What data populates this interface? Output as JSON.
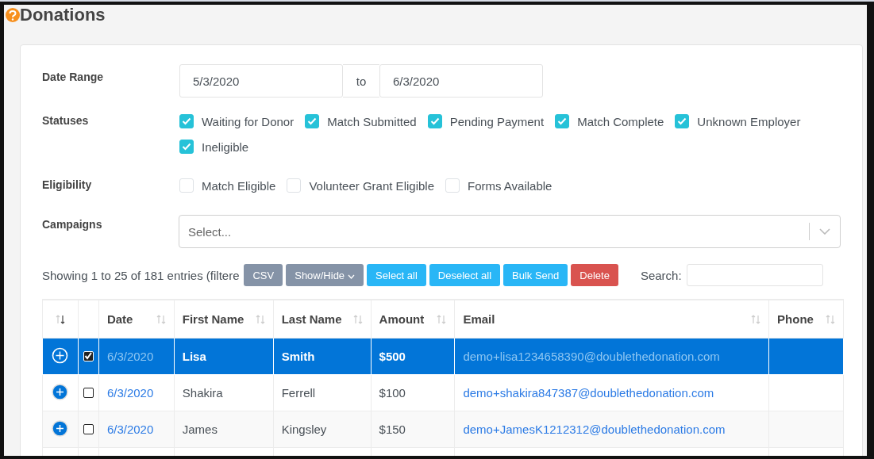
{
  "page": {
    "title": "Donations"
  },
  "filters": {
    "date_range": {
      "label": "Date Range",
      "from": "5/3/2020",
      "separator": "to",
      "to": "6/3/2020"
    },
    "statuses": {
      "label": "Statuses",
      "options": [
        {
          "label": "Waiting for Donor",
          "checked": true
        },
        {
          "label": "Match Submitted",
          "checked": true
        },
        {
          "label": "Pending Payment",
          "checked": true
        },
        {
          "label": "Match Complete",
          "checked": true
        },
        {
          "label": "Unknown Employer",
          "checked": true
        },
        {
          "label": "Ineligible",
          "checked": true
        }
      ]
    },
    "eligibility": {
      "label": "Eligibility",
      "options": [
        {
          "label": "Match Eligible",
          "checked": false
        },
        {
          "label": "Volunteer Grant Eligible",
          "checked": false
        },
        {
          "label": "Forms Available",
          "checked": false
        }
      ]
    },
    "campaigns": {
      "label": "Campaigns",
      "placeholder": "Select..."
    }
  },
  "toolbar": {
    "info": "Showing 1 to 25 of 181 entries (filtere",
    "buttons": [
      {
        "label": "CSV",
        "kind": "secondary"
      },
      {
        "label": "Show/Hide",
        "kind": "dropdown"
      },
      {
        "label": "Select all",
        "kind": "info"
      },
      {
        "label": "Deselect all",
        "kind": "info"
      },
      {
        "label": "Bulk Send",
        "kind": "info"
      },
      {
        "label": "Delete",
        "kind": "danger"
      }
    ],
    "search_label": "Search:"
  },
  "table": {
    "columns": [
      {
        "kind": "expand",
        "sorted": true
      },
      {
        "kind": "select"
      },
      {
        "kind": "data",
        "label": "Date",
        "sorted": false
      },
      {
        "kind": "data",
        "label": "First Name",
        "sorted": false
      },
      {
        "kind": "data",
        "label": "Last Name",
        "sorted": false
      },
      {
        "kind": "data",
        "label": "Amount",
        "sorted": false
      },
      {
        "kind": "data",
        "label": "Email",
        "sorted": false
      },
      {
        "kind": "data",
        "label": "Phone",
        "sorted": false
      }
    ],
    "rows": [
      {
        "selected": true,
        "checked": true,
        "date": "6/3/2020",
        "first_name": "Lisa",
        "last_name": "Smith",
        "amount": "$500",
        "email": "demo+lisa1234658390@doublethedonation.com"
      },
      {
        "selected": false,
        "checked": false,
        "date": "6/3/2020",
        "first_name": "Shakira",
        "last_name": "Ferrell",
        "amount": "$100",
        "email": "demo+shakira847387@doublethedonation.com"
      },
      {
        "selected": false,
        "checked": false,
        "date": "6/3/2020",
        "first_name": "James",
        "last_name": "Kingsley",
        "amount": "$150",
        "email": "demo+JamesK1212312@doublethedonation.com"
      }
    ]
  }
}
